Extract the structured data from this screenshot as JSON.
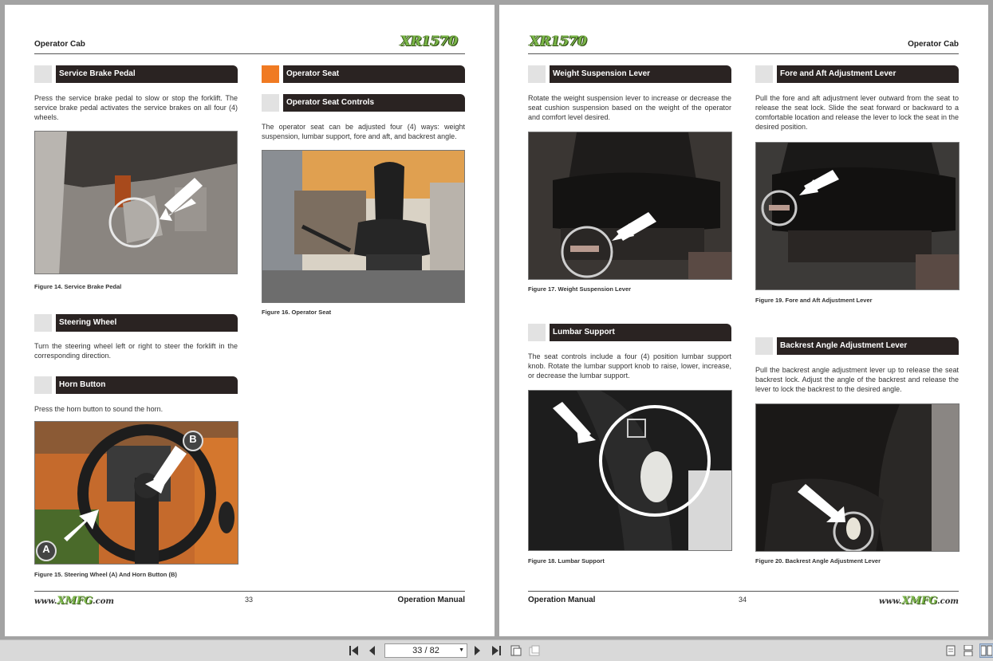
{
  "left_page": {
    "header_title": "Operator Cab",
    "logo_text": "XR1570",
    "sections": {
      "service_brake": {
        "title": "Service Brake Pedal",
        "text": "Press the service brake pedal to slow or stop the forklift. The service brake pedal activates the service brakes on all four (4) wheels.",
        "caption": "Figure 14.  Service Brake Pedal"
      },
      "steering": {
        "title": "Steering Wheel",
        "text": "Turn the steering wheel left or right to steer the forklift in the corresponding direction."
      },
      "horn": {
        "title": "Horn Button",
        "text": "Press the horn button to sound the horn.",
        "caption": "Figure 15.  Steering Wheel (A) And  Horn Button (B)",
        "label_a": "A",
        "label_b": "B"
      },
      "operator_seat": {
        "title": "Operator Seat",
        "caption": "Figure 16.  Operator Seat"
      },
      "seat_controls": {
        "title": "Operator Seat Controls",
        "text": "The operator seat can be adjusted four (4) ways: weight suspension, lumbar support, fore and aft, and backrest angle."
      }
    },
    "footer_web": "www.XMFG.com",
    "footer_web_parts": {
      "pre": "www.",
      "brand": "XMFG",
      "post": ".com"
    },
    "page_number": "33",
    "footer_title": "Operation Manual"
  },
  "right_page": {
    "header_title": "Operator Cab",
    "logo_text": "XR1570",
    "sections": {
      "weight": {
        "title": "Weight Suspension Lever",
        "text": "Rotate the weight suspension lever to increase or decrease the seat cushion suspension based on the weight of the operator and comfort level desired.",
        "caption": "Figure 17.  Weight Suspension Lever"
      },
      "lumbar": {
        "title": "Lumbar Support",
        "text": "The seat controls include a four (4) position lumbar support knob. Rotate the lumbar support knob to raise, lower, increase, or decrease the lumbar support.",
        "caption": "Figure 18.  Lumbar Support"
      },
      "fore_aft": {
        "title": "Fore and Aft Adjustment Lever",
        "text": "Pull the fore and aft adjustment lever outward from the seat to release the seat lock. Slide the seat forward or backward to a comfortable location and release the lever to lock the seat in the desired position.",
        "caption": "Figure 19.  Fore and Aft Adjustment Lever"
      },
      "backrest": {
        "title": "Backrest Angle Adjustment Lever",
        "text": "Pull the backrest angle adjustment lever up to release the seat backrest lock. Adjust the angle of the backrest and release the lever to lock the backrest to the desired angle.",
        "caption": "Figure 20.  Backrest Angle Adjustment Lever"
      }
    },
    "footer_title": "Operation Manual",
    "page_number": "34",
    "footer_web": "www.XMFG.com",
    "footer_web_parts": {
      "pre": "www.",
      "brand": "XMFG",
      "post": ".com"
    }
  },
  "toolbar": {
    "page_indicator": "33 / 82",
    "buttons": [
      "first-page-icon",
      "prev-page-icon",
      "next-page-icon",
      "last-page-icon",
      "fit-page-icon",
      "fit-width-icon",
      "single-page-view-icon",
      "continuous-view-icon",
      "two-page-view-icon"
    ]
  },
  "colors": {
    "section_bar": "#2a2322",
    "section_square": "#e2e2e2",
    "accent_orange": "#f07a22",
    "logo_green": "#7ab648",
    "background": "#a3a3a3"
  }
}
